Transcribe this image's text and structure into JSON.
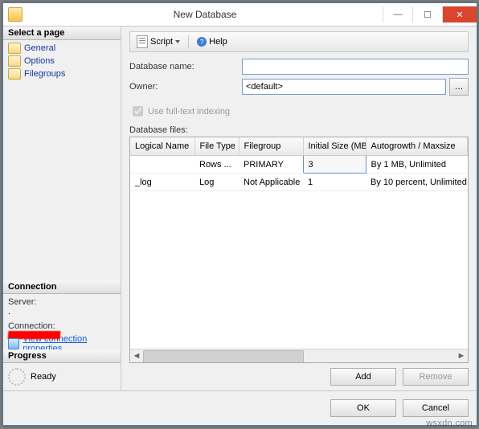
{
  "window": {
    "title": "New Database",
    "min": "—",
    "max": "☐",
    "close": "✕"
  },
  "sidebar": {
    "select_page_header": "Select a page",
    "pages": [
      {
        "label": "General"
      },
      {
        "label": "Options"
      },
      {
        "label": "Filegroups"
      }
    ],
    "connection_header": "Connection",
    "server_label": "Server:",
    "server_value": ".",
    "connection_label": "Connection:",
    "view_conn_props": "View connection properties",
    "progress_header": "Progress",
    "progress_status": "Ready"
  },
  "toolbar": {
    "script_label": "Script",
    "help_label": "Help"
  },
  "form": {
    "dbname_label": "Database name:",
    "dbname_value": "",
    "owner_label": "Owner:",
    "owner_value": "<default>",
    "fulltext_label": "Use full-text indexing"
  },
  "grid": {
    "section_label": "Database files:",
    "columns": [
      "Logical Name",
      "File Type",
      "Filegroup",
      "Initial Size (MB)",
      "Autogrowth / Maxsize"
    ],
    "rows": [
      {
        "logical": "",
        "ftype": "Rows ...",
        "fg": "PRIMARY",
        "size": "3",
        "growth": "By 1 MB, Unlimited"
      },
      {
        "logical": "_log",
        "ftype": "Log",
        "fg": "Not Applicable",
        "size": "1",
        "growth": "By 10 percent, Unlimited"
      }
    ]
  },
  "buttons": {
    "add": "Add",
    "remove": "Remove",
    "ok": "OK",
    "cancel": "Cancel"
  },
  "watermark": "wsxdn.com"
}
